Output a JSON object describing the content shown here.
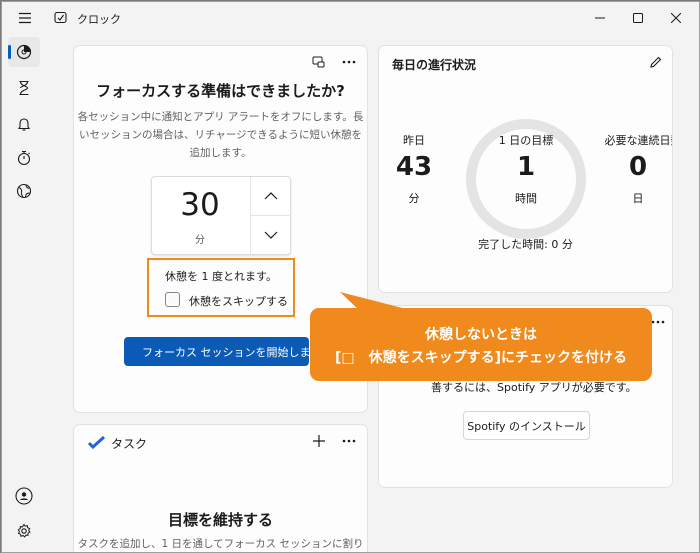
{
  "window": {
    "title": "クロック"
  },
  "titlebar": {
    "minimize_icon": "minimize-icon",
    "maximize_icon": "maximize-icon",
    "close_icon": "close-icon"
  },
  "nav": {
    "items": [
      {
        "name": "nav-focus-session",
        "icon": "focus-icon",
        "active": true
      },
      {
        "name": "nav-timer",
        "icon": "hourglass-icon"
      },
      {
        "name": "nav-alarm",
        "icon": "bell-icon"
      },
      {
        "name": "nav-stopwatch",
        "icon": "stopwatch-icon"
      },
      {
        "name": "nav-world-clock",
        "icon": "globe-icon"
      }
    ],
    "bottom": [
      {
        "name": "nav-account",
        "icon": "account-icon"
      },
      {
        "name": "nav-settings",
        "icon": "gear-icon"
      }
    ]
  },
  "focus": {
    "heading": "フォーカスする準備はできましたか?",
    "desc_line1": "各セッション中に通知とアプリ アラートをオフにします。長",
    "desc_line2": "いセッションの場合は、リチャージできるように短い休憩を",
    "desc_line3": "追加します。",
    "minutes": "30",
    "unit": "分",
    "break_text": "休憩を 1 度とれます。",
    "skip_label": "休憩をスキップする",
    "skip_checked": false,
    "start_label": "フォーカス セッションを開始します"
  },
  "daily": {
    "title": "毎日の進行状況",
    "yesterday_label": "昨日",
    "yesterday_value": "43",
    "yesterday_unit": "分",
    "goal_label": "1 日の目標",
    "goal_value": "1",
    "goal_unit": "時間",
    "streak_label": "必要な連続日数",
    "streak_value": "0",
    "streak_unit": "日",
    "completed": "完了した時間: 0 分",
    "goal_progress": 0
  },
  "tasks": {
    "title": "タスク",
    "heading": "目標を維持する",
    "desc": "タスクを追加し、1 日を通してフォーカス セッションに割り"
  },
  "spotify": {
    "desc": "善するには、Spotify アプリが必要です。",
    "install_label": "Spotify のインストール"
  },
  "callout": {
    "line1": "休憩しないときは",
    "line2": "[□　休憩をスキップする]にチェックを付ける"
  },
  "colors": {
    "accent": "#0b5ab5",
    "annotation": "#f08a1c"
  }
}
